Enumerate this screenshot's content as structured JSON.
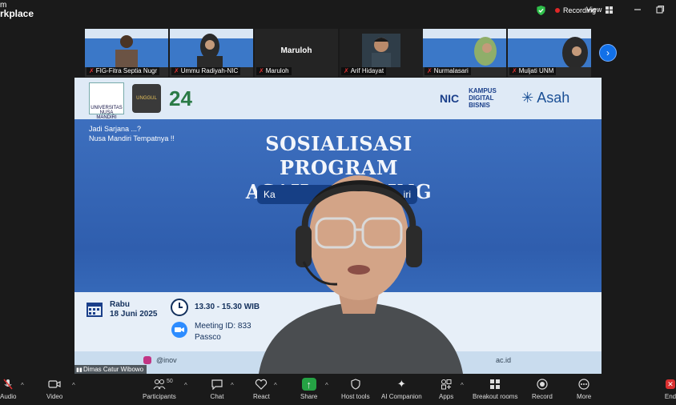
{
  "app": {
    "title_line1": "m",
    "title_line2": "rkplace"
  },
  "status": {
    "recording_label": "Recording",
    "view_label": "View"
  },
  "participants_strip": [
    {
      "name": "FIG-Fitra Septia Nugr",
      "muted": true
    },
    {
      "name": "Ummu Radiyah-NIC",
      "muted": true
    },
    {
      "name": "Maruloh",
      "muted": true,
      "display_name": "Maruloh"
    },
    {
      "name": "Arif Hidayat",
      "muted": true
    },
    {
      "name": "Nurmalasari",
      "muted": true
    },
    {
      "name": "Muljati UNM",
      "muted": true
    }
  ],
  "slide": {
    "tagline_line1": "Jadi Sarjana ...?",
    "tagline_line2": "Nusa Mandiri Tempatnya !!",
    "title_line1": "SOSIALISASI PROGRAM",
    "title_line2": "ASAH    CODING",
    "pill_left": "Ka",
    "pill_right": "iri",
    "logo_unm": "UNIVERSITAS NUSA MANDIRI",
    "logo_unggul": "UNGGUL",
    "logo_24": "24",
    "logo_nic": "NIC",
    "logo_kampus": "KAMPUS DIGITAL BISNIS",
    "logo_asah": "Asah",
    "day": "Rabu",
    "date": "18 Juni 2025",
    "time": "13.30 - 15.30 WIB",
    "meeting_id_label": "Meeting ID: 833",
    "passcode_label": "Passco",
    "footer_ig": "@inov",
    "footer_web": "ac.id"
  },
  "speaker": {
    "name": "Dimas Catur Wibowo"
  },
  "toolbar": {
    "audio": "Audio",
    "video": "Video",
    "participants": "Participants",
    "participants_count": "50",
    "chat": "Chat",
    "react": "React",
    "share": "Share",
    "host_tools": "Host tools",
    "ai_companion": "AI Companion",
    "apps": "Apps",
    "breakout_rooms": "Breakout rooms",
    "record": "Record",
    "more": "More",
    "end": "End"
  },
  "colors": {
    "accent": "#1170e8",
    "record": "#e02828",
    "share": "#25a244"
  }
}
